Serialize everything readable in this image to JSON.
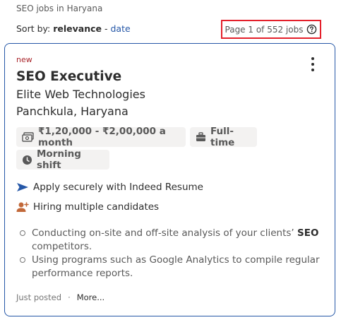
{
  "breadcrumb": "SEO jobs in Haryana",
  "sort": {
    "prefix": "Sort by:",
    "active": "relevance",
    "separator": "-",
    "other": "date"
  },
  "pagination": {
    "text": "Page 1 of 552 jobs",
    "icon": "help-circle-icon"
  },
  "job": {
    "badge": "new",
    "title": "SEO Executive",
    "company": "Elite Web Technologies",
    "location": "Panchkula, Haryana",
    "salary": "₹1,20,000 - ₹2,00,000 a month",
    "job_type": "Full-time",
    "shift": "Morning shift",
    "features": [
      {
        "icon": "send-arrow-icon",
        "text": "Apply securely with Indeed Resume"
      },
      {
        "icon": "add-person-icon",
        "text": "Hiring multiple candidates"
      }
    ],
    "snippet": [
      {
        "before": "Conducting on-site and off-site analysis of your clients’ ",
        "bold": "SEO",
        "after": " competitors."
      },
      {
        "before": "Using programs such as Google Analytics to compile regular performance reports.",
        "bold": "",
        "after": ""
      }
    ],
    "posted": "Just posted",
    "dot": "·",
    "more": "More..."
  },
  "colors": {
    "accent": "#2557a7",
    "new_badge": "#a9252b",
    "highlight_border": "#e4202b"
  }
}
